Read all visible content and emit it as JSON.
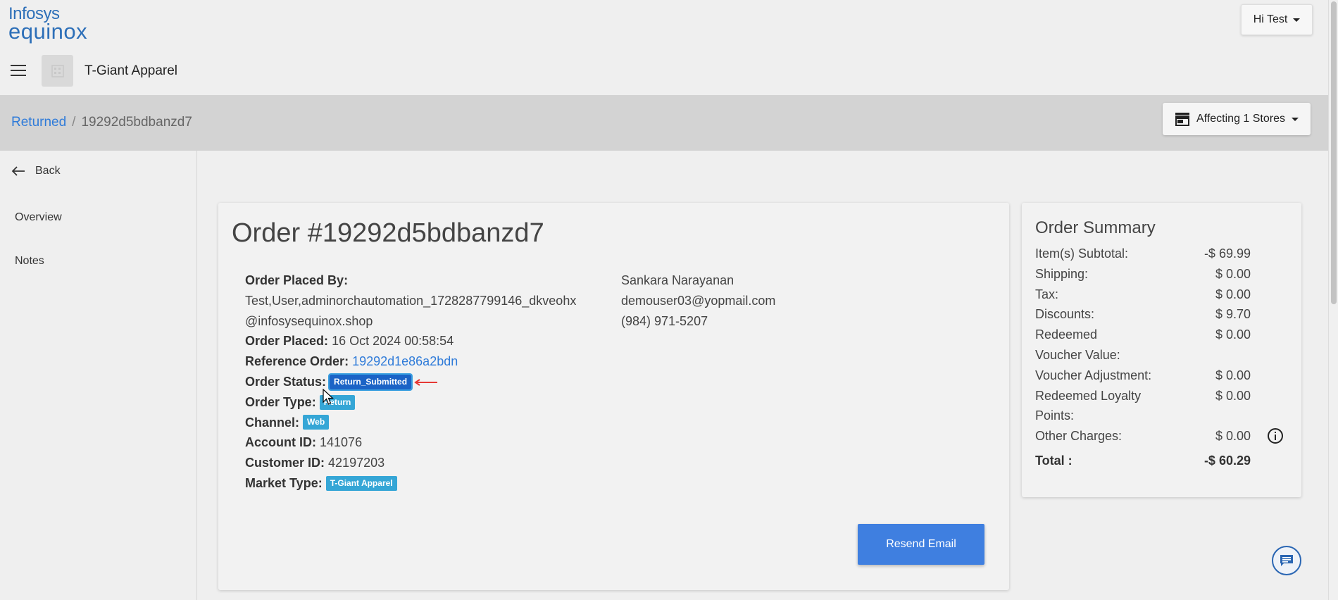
{
  "logo": {
    "line1": "Infosys",
    "line2": "equinox"
  },
  "user_menu": {
    "label": "Hi Test"
  },
  "store": {
    "name": "T-Giant Apparel"
  },
  "breadcrumb": {
    "parent": "Returned",
    "separator": "/",
    "current": "19292d5bdbanzd7"
  },
  "affecting": {
    "label": "Affecting 1 Stores"
  },
  "sidebar": {
    "back": "Back",
    "items": [
      {
        "label": "Overview"
      },
      {
        "label": "Notes"
      }
    ]
  },
  "order": {
    "title": "Order #19292d5bdbanzd7",
    "placed_by_label": "Order Placed By:",
    "placed_by_line1": "Test,User,adminorchautomation_1728287799146_dkveohx",
    "placed_by_line2": "@infosysequinox.shop",
    "placed_label": "Order Placed:",
    "placed_value": "16 Oct 2024 00:58:54",
    "reference_label": "Reference Order:",
    "reference_value": "19292d1e86a2bdn",
    "status_label": "Order Status:",
    "status_value": "Return_Submitted",
    "type_label": "Order Type:",
    "type_value": "Return",
    "channel_label": "Channel:",
    "channel_value": "Web",
    "account_label": "Account ID:",
    "account_value": "141076",
    "customer_label": "Customer ID:",
    "customer_value": "42197203",
    "market_label": "Market Type:",
    "market_value": "T-Giant Apparel"
  },
  "contact": {
    "name": "Sankara Narayanan",
    "email": "demouser03@yopmail.com",
    "phone": "(984) 971-5207"
  },
  "actions": {
    "resend_email": "Resend Email"
  },
  "summary": {
    "title": "Order Summary",
    "rows": [
      {
        "label": "Item(s) Subtotal:",
        "value": "-$ 69.99"
      },
      {
        "label": "Shipping:",
        "value": "$ 0.00"
      },
      {
        "label": "Tax:",
        "value": "$ 0.00"
      },
      {
        "label": "Discounts:",
        "value": "$ 9.70"
      },
      {
        "label": "Redeemed Voucher Value:",
        "value": "$ 0.00"
      },
      {
        "label": "Voucher Adjustment:",
        "value": "$ 0.00"
      },
      {
        "label": "Redeemed Loyalty Points:",
        "value": "$ 0.00"
      },
      {
        "label": "Other Charges:",
        "value": "$ 0.00"
      }
    ],
    "total_label": "Total :",
    "total_value": "-$ 60.29"
  },
  "colors": {
    "accent": "#2f7bd9",
    "badge": "#35a6d6",
    "badge_selected": "#1b63c6",
    "button": "#3f7fe0",
    "annotation_arrow": "#e53935"
  },
  "icons": {
    "hamburger": "menu-icon",
    "store": "building-icon",
    "affecting": "storefront-icon",
    "back": "arrow-left-icon",
    "info": "info-circle-icon",
    "chat": "chat-bubble-icon"
  }
}
